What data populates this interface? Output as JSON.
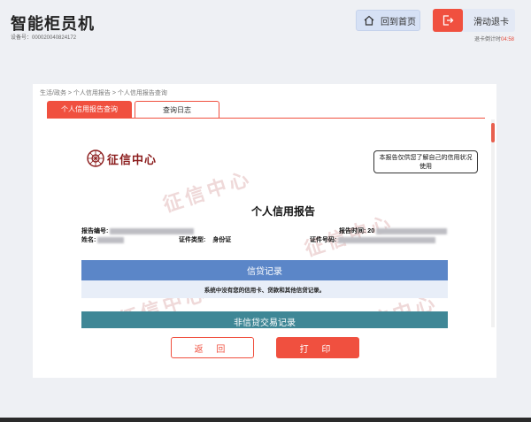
{
  "app": {
    "title": "智能柜员机",
    "device_id": "设备号：000020040824172"
  },
  "header": {
    "home_label": "回到首页",
    "exit_label": "滑动退卡",
    "countdown_prefix": "退卡倒计时",
    "countdown_time": "04:58"
  },
  "breadcrumb": "生活/政务 > 个人信用报告 > 个人信用报告查询",
  "tabs": [
    {
      "label": "个人信用报告查询",
      "active": true
    },
    {
      "label": "查询日志",
      "active": false
    }
  ],
  "report": {
    "logo_name": "征信中心",
    "disclaimer": "本报告仅供您了解自己的信用状况使用",
    "title": "个人信用报告",
    "report_no_label": "报告编号:",
    "report_time_label": "报告时间:",
    "report_time_value": "20",
    "name_label": "姓名:",
    "name_value": "",
    "id_type_label": "证件类型:",
    "id_type_value": "身份证",
    "id_no_label": "证件号码:",
    "section_credit": "信贷记录",
    "credit_note": "系统中没有您的信用卡、贷款和其他信贷记录。",
    "section_noncredit": "非信贷交易记录",
    "watermark": "征信中心"
  },
  "actions": {
    "back_label": "返 回",
    "print_label": "打 印"
  }
}
